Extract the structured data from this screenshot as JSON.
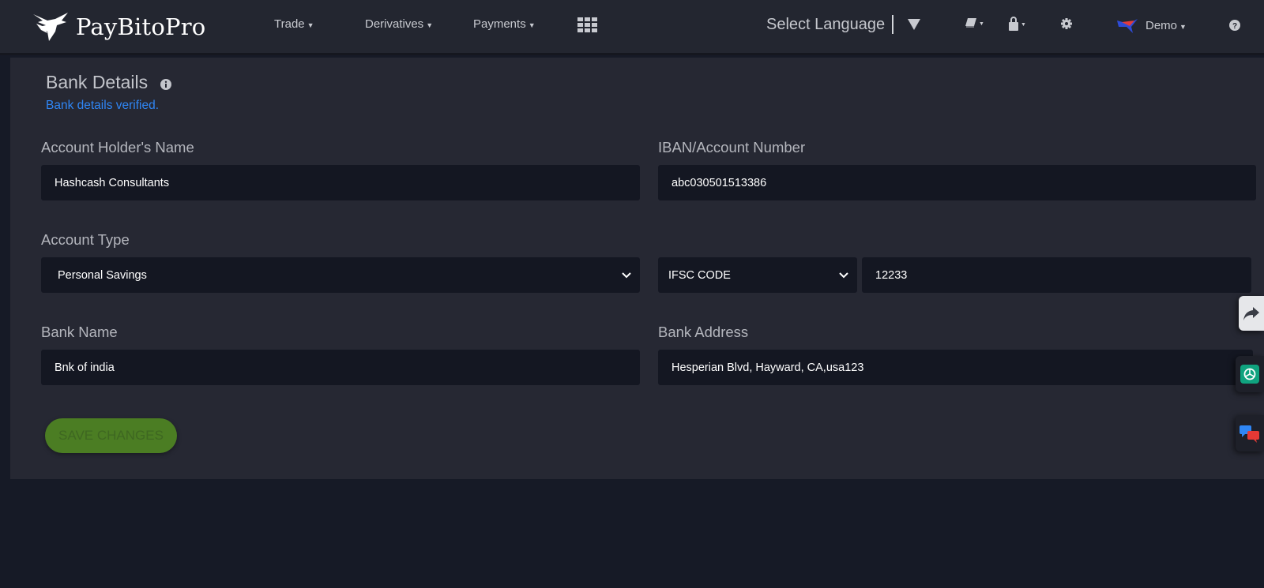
{
  "brand": {
    "name": "PayBitoPro"
  },
  "nav": {
    "items": [
      {
        "label": "Trade"
      },
      {
        "label": "Derivatives"
      },
      {
        "label": "Payments"
      }
    ],
    "language_label": "Select Language",
    "user_label": "Demo"
  },
  "icons": {
    "logo": "eagle-logo-icon",
    "apps": "grid-apps-icon",
    "language_dropdown": "triangle-down-icon",
    "book": "book-icon",
    "lock": "lock-icon",
    "settings": "gear-icon",
    "user_flag": "flag-avatar-icon",
    "help": "question-circle-icon",
    "info": "info-circle-icon",
    "share": "share-arrow-icon",
    "chatgpt": "chatgpt-icon",
    "chat": "chat-bubbles-icon"
  },
  "bank_details": {
    "title": "Bank Details",
    "status": "Bank details verified.",
    "account_holder": {
      "label": "Account Holder's Name",
      "value": "Hashcash Consultants"
    },
    "account_number": {
      "label": "IBAN/Account Number",
      "value": "abc030501513386"
    },
    "account_type": {
      "label": "Account Type",
      "value": "Personal Savings"
    },
    "code_type": {
      "value": "IFSC CODE"
    },
    "code_value": {
      "value": "12233"
    },
    "bank_name": {
      "label": "Bank Name",
      "value": "Bnk of india"
    },
    "bank_address": {
      "label": "Bank Address",
      "value": "Hesperian Blvd, Hayward, CA,usa123"
    },
    "save_label": "SAVE CHANGES"
  },
  "colors": {
    "background": "#161a26",
    "topbar": "#232630",
    "panel": "#262833",
    "field": "#141722",
    "accent_blue": "#2f86f5",
    "save_green": "#4b7d23"
  }
}
